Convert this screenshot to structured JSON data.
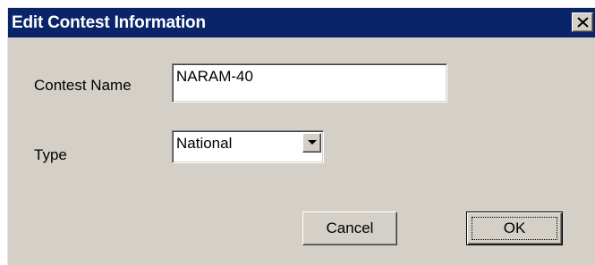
{
  "dialog": {
    "title": "Edit Contest Information"
  },
  "form": {
    "contest_name_label": "Contest Name",
    "contest_name_value": "NARAM-40",
    "type_label": "Type",
    "type_value": "National"
  },
  "buttons": {
    "cancel_label": "Cancel",
    "ok_label": "OK"
  },
  "icons": {
    "close": "close-icon",
    "dropdown": "chevron-down-icon"
  },
  "colors": {
    "titlebar": "#0a246a",
    "face": "#d4d0c8",
    "field": "#ffffff"
  }
}
